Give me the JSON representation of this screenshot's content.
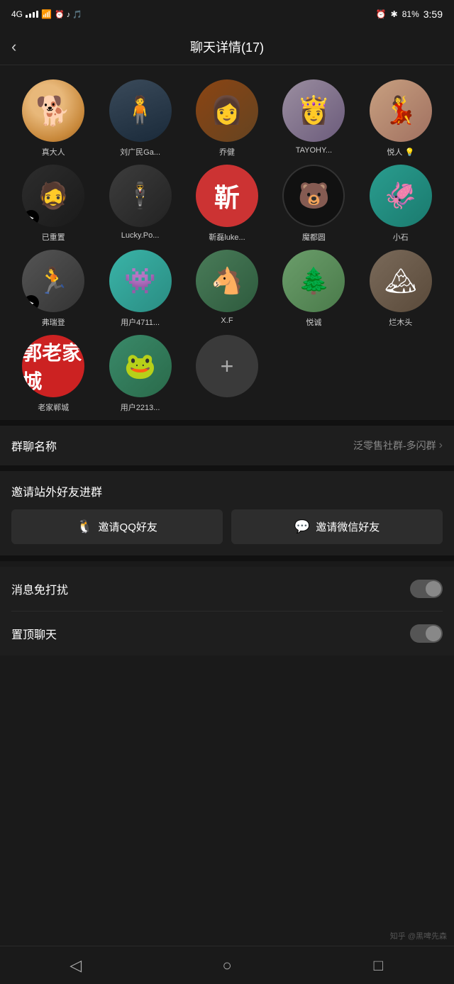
{
  "statusBar": {
    "network": "4G",
    "signal": "4G",
    "time": "3:59",
    "battery": "81%"
  },
  "header": {
    "title": "聊天详情(17)",
    "backLabel": "‹"
  },
  "members": [
    {
      "id": 1,
      "name": "真大人",
      "avatarType": "shiba",
      "emoji": "🐕"
    },
    {
      "id": 2,
      "name": "刘广民Ga...",
      "avatarType": "man",
      "emoji": "👤"
    },
    {
      "id": 3,
      "name": "乔健",
      "avatarType": "girl1",
      "emoji": "👩"
    },
    {
      "id": 4,
      "name": "TAYOHY...",
      "avatarType": "lady",
      "emoji": "👸"
    },
    {
      "id": 5,
      "name": "悦人 💡",
      "avatarType": "vintage",
      "emoji": "💃"
    },
    {
      "id": 6,
      "name": "已重置",
      "avatarType": "glasses",
      "emoji": "🕶"
    },
    {
      "id": 7,
      "name": "Lucky.Po...",
      "avatarType": "suit",
      "emoji": "🕴"
    },
    {
      "id": 8,
      "name": "靳磊luke...",
      "avatarType": "hanzi",
      "text": "靳"
    },
    {
      "id": 9,
      "name": "魔都圆",
      "avatarType": "bear",
      "emoji": "🐻"
    },
    {
      "id": 10,
      "name": "小石",
      "avatarType": "monster",
      "emoji": "👾"
    },
    {
      "id": 11,
      "name": "弗瑞登",
      "avatarType": "runner",
      "emoji": "🏃"
    },
    {
      "id": 12,
      "name": "用户4711...",
      "avatarType": "monster2",
      "emoji": "👾"
    },
    {
      "id": 13,
      "name": "X.F",
      "avatarType": "horse",
      "emoji": "🐴"
    },
    {
      "id": 14,
      "name": "悦诚",
      "avatarType": "nature",
      "emoji": "🌿"
    },
    {
      "id": 15,
      "name": "烂木头",
      "avatarType": "outdoor",
      "emoji": "🏔"
    },
    {
      "id": 16,
      "name": "老家郸城",
      "avatarType": "郭",
      "text": "郭"
    },
    {
      "id": 17,
      "name": "用户2213...",
      "avatarType": "frog",
      "emoji": "🐸"
    }
  ],
  "addButton": {
    "label": "+"
  },
  "groupName": {
    "label": "群聊名称",
    "value": "泛零售社群-多闪群"
  },
  "inviteSection": {
    "title": "邀请站外好友进群",
    "qqButton": "邀请QQ好友",
    "wechatButton": "邀请微信好友"
  },
  "toggles": [
    {
      "id": "dnd",
      "label": "消息免打扰",
      "enabled": false
    },
    {
      "id": "pin",
      "label": "置顶聊天",
      "enabled": false
    }
  ],
  "bottomNav": {
    "back": "◁",
    "home": "○",
    "recent": "□"
  },
  "watermark": "知乎 @黑啤先森"
}
